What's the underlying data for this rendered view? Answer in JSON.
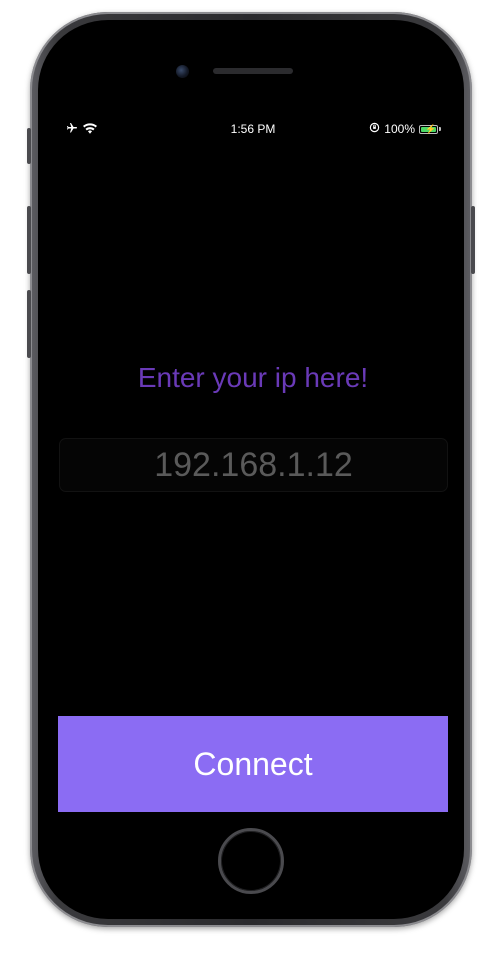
{
  "status_bar": {
    "left_icons": [
      "airplane-icon",
      "wifi-icon"
    ],
    "time": "1:56 PM",
    "right_icons": [
      "orientation-lock-icon",
      "battery-charging-icon"
    ],
    "battery_percent": "100%",
    "battery_level": 1.0
  },
  "main": {
    "prompt": "Enter your ip here!",
    "ip_input": {
      "placeholder": "192.168.1.12",
      "value": ""
    },
    "connect_label": "Connect"
  },
  "colors": {
    "prompt_text": "#6a3ab8",
    "button_background": "#8b6cf3",
    "button_text": "#ffffff",
    "placeholder_text": "#5a5a5a",
    "screen_background": "#000000",
    "battery_fill": "#4cd964"
  }
}
